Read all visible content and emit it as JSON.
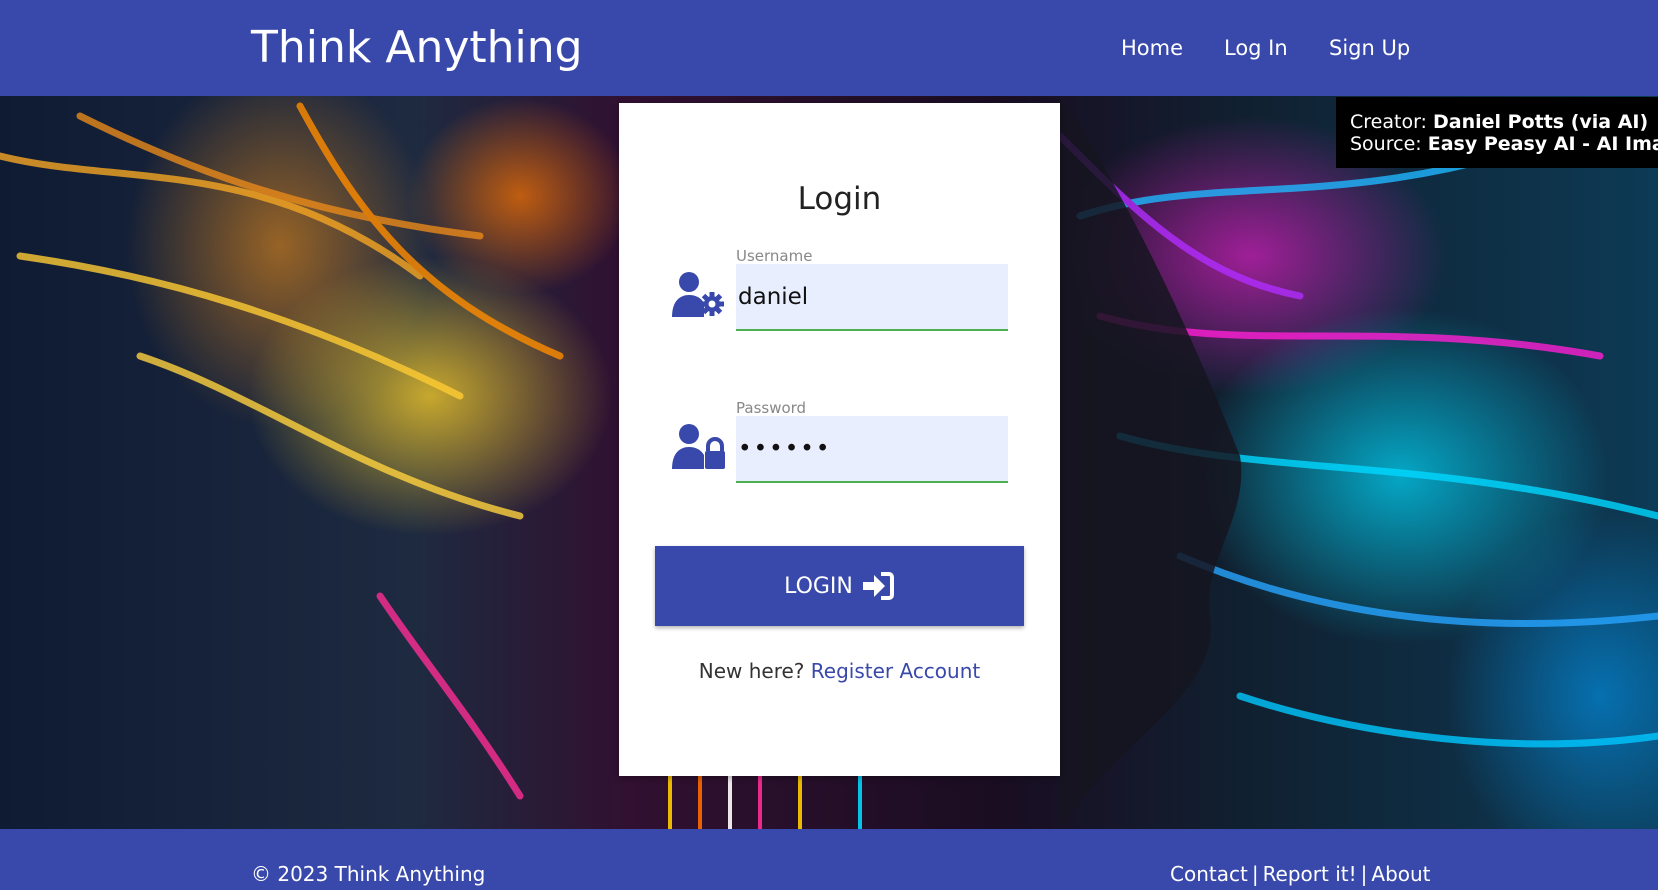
{
  "header": {
    "brand": "Think Anything",
    "nav": [
      {
        "label": "Home"
      },
      {
        "label": "Log In"
      },
      {
        "label": "Sign Up"
      }
    ]
  },
  "credit": {
    "creator_label": "Creator:",
    "creator": "Daniel Potts (via AI)",
    "source_label": "Source:",
    "source": "Easy Peasy AI - AI Images"
  },
  "login": {
    "title": "Login",
    "username_label": "Username",
    "username_value": "daniel",
    "password_label": "Password",
    "password_value": "••••••",
    "button_label": "LOGIN",
    "register_prompt": "New here?",
    "register_link": "Register Account"
  },
  "footer": {
    "copyright": "© 2023 Think Anything",
    "links": [
      {
        "label": "Contact"
      },
      {
        "label": "Report it!"
      },
      {
        "label": "About"
      }
    ],
    "separator": "|"
  },
  "colors": {
    "primary": "#3949ab",
    "input_bg": "#e8eefd",
    "input_underline": "#4caf50"
  },
  "icons": [
    "user-gear-icon",
    "user-lock-icon",
    "sign-in-icon"
  ]
}
